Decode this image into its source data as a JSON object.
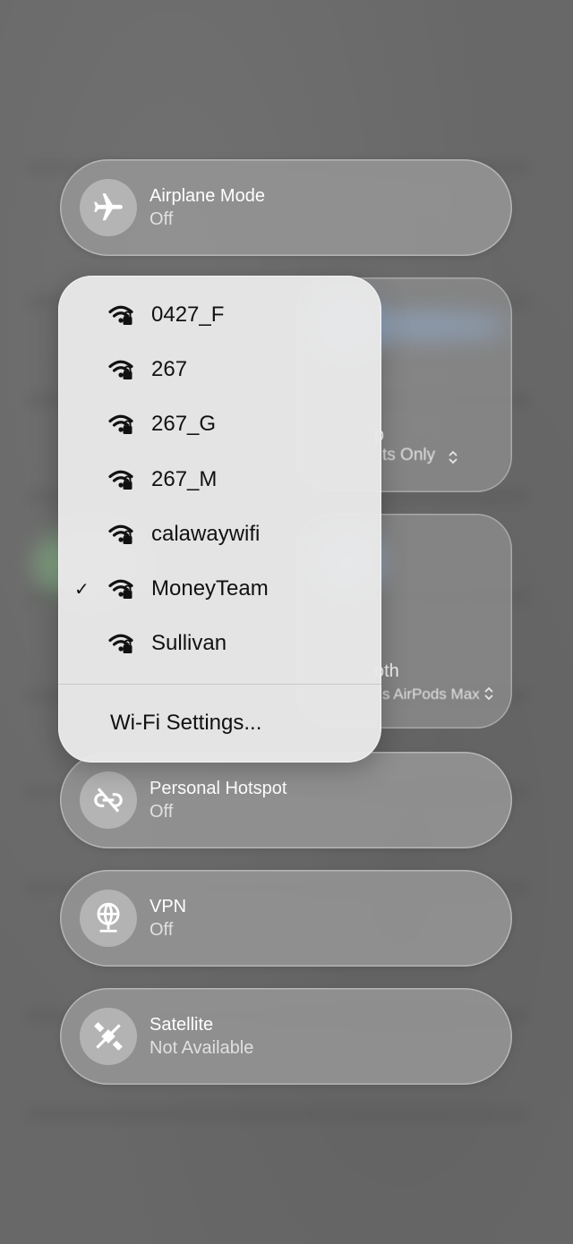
{
  "controls": {
    "airplane": {
      "title": "Airplane Mode",
      "status": "Off"
    },
    "hotspot": {
      "title": "Personal Hotspot",
      "status": "Off"
    },
    "vpn": {
      "title": "VPN",
      "status": "Off"
    },
    "satellite": {
      "title": "Satellite",
      "status": "Not Available"
    }
  },
  "behind_tiles": {
    "airdrop": {
      "title_fragment": "p",
      "sub_fragment": "ts Only"
    },
    "bluetooth": {
      "title_fragment": "oth",
      "sub_fragment": "s AirPods Max"
    }
  },
  "wifi_menu": {
    "networks": [
      {
        "name": "0427_F",
        "secured": true,
        "connected": false
      },
      {
        "name": "267",
        "secured": true,
        "connected": false
      },
      {
        "name": "267_G",
        "secured": true,
        "connected": false
      },
      {
        "name": "267_M",
        "secured": true,
        "connected": false
      },
      {
        "name": "calawaywifi",
        "secured": true,
        "connected": false
      },
      {
        "name": "MoneyTeam",
        "secured": true,
        "connected": true
      },
      {
        "name": "Sullivan",
        "secured": true,
        "connected": false
      }
    ],
    "settings_label": "Wi-Fi Settings...",
    "check_glyph": "✓"
  },
  "icons": {
    "airplane": "airplane-icon",
    "hotspot": "link-slash-icon",
    "vpn": "globe-network-icon",
    "satellite": "satellite-slash-icon",
    "wifi": "wifi-lock-icon"
  }
}
